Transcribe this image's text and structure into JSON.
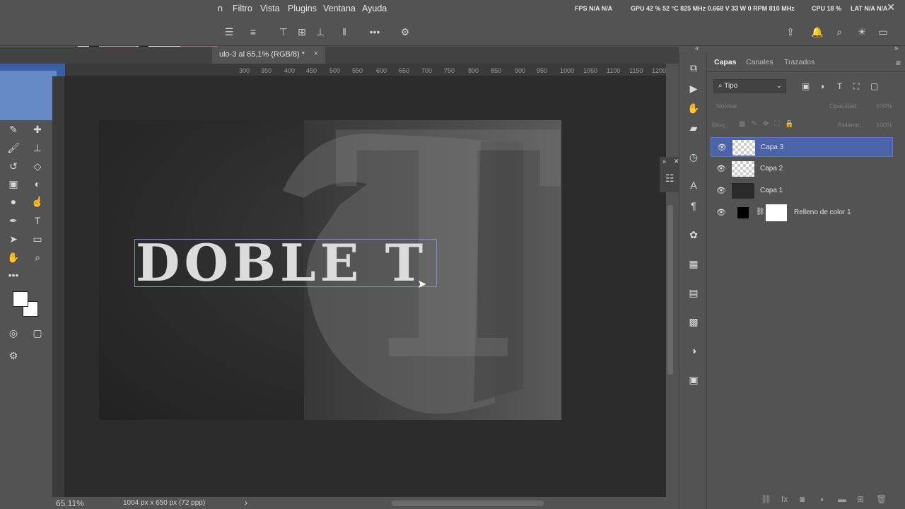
{
  "menu": [
    "Filtro",
    "Vista",
    "Plugins",
    "Ventana",
    "Ayuda"
  ],
  "menu_partial": "n",
  "system_stats": {
    "fps": "FPS N/A N/A",
    "gpu": "GPU 42 % 52 °C 825 MHz 0.668 V 33 W 0 RPM 810 MHz",
    "cpu": "CPU 18 %",
    "lat": "LAT N/A N/A"
  },
  "document_tab": {
    "title": "ulo-3 al 65,1% (RGB/8) *",
    "close": "×"
  },
  "ruler_ticks": [
    "300",
    "350",
    "400",
    "450",
    "500",
    "550",
    "600",
    "650",
    "700",
    "750",
    "800",
    "850",
    "900",
    "950",
    "1000",
    "1050",
    "1100",
    "1150",
    "1200"
  ],
  "canvas": {
    "headline": "DOBLE T",
    "big_glyph": "T"
  },
  "status": {
    "zoom": "65.11%",
    "doc_size": "1004 px x 650 px (72 ppp)",
    "arrow": "›"
  },
  "panel": {
    "tabs": [
      "Capas",
      "Canales",
      "Trazados"
    ],
    "filter": "Tipo",
    "blend_mode": "Normal",
    "opacity_label": "Opacidad:",
    "opacity_value": "100%",
    "lock_label": "Bloq.:",
    "fill_label": "Relleno:",
    "fill_value": "100%",
    "layers": [
      {
        "name": "Capa 3",
        "selected": true,
        "thumb": "checker"
      },
      {
        "name": "Capa 2",
        "selected": false,
        "thumb": "checker"
      },
      {
        "name": "Capa 1",
        "selected": false,
        "thumb": "dark"
      },
      {
        "name": "Relleno de color 1",
        "selected": false,
        "thumb": "fill"
      }
    ]
  },
  "icons": {
    "tools": [
      "eyedropper-icon",
      "healing-brush-icon",
      "brush-icon",
      "clone-stamp-icon",
      "history-brush-icon",
      "eraser-icon",
      "gradient-icon",
      "blur-icon",
      "dodge-icon",
      "smudge-icon",
      "pen-icon",
      "type-icon",
      "path-select-icon",
      "rectangle-icon",
      "hand-icon",
      "zoom-icon",
      "more-tools-icon",
      "quick-mask-icon",
      "screen-mode-icon",
      "edit-toolbar-icon"
    ],
    "right_strip": [
      "history-icon",
      "play-icon",
      "hand-icon",
      "comment-icon",
      "clock-icon",
      "character-icon",
      "paragraph-icon",
      "palette-icon",
      "grid-icon",
      "gradient-icon",
      "pattern-icon",
      "adjust-icon",
      "libraries-icon"
    ]
  },
  "colors": {
    "accent_selection": "#4b63a8",
    "ui_bg": "#535353",
    "canvas_bg": "#2c2c2c"
  }
}
